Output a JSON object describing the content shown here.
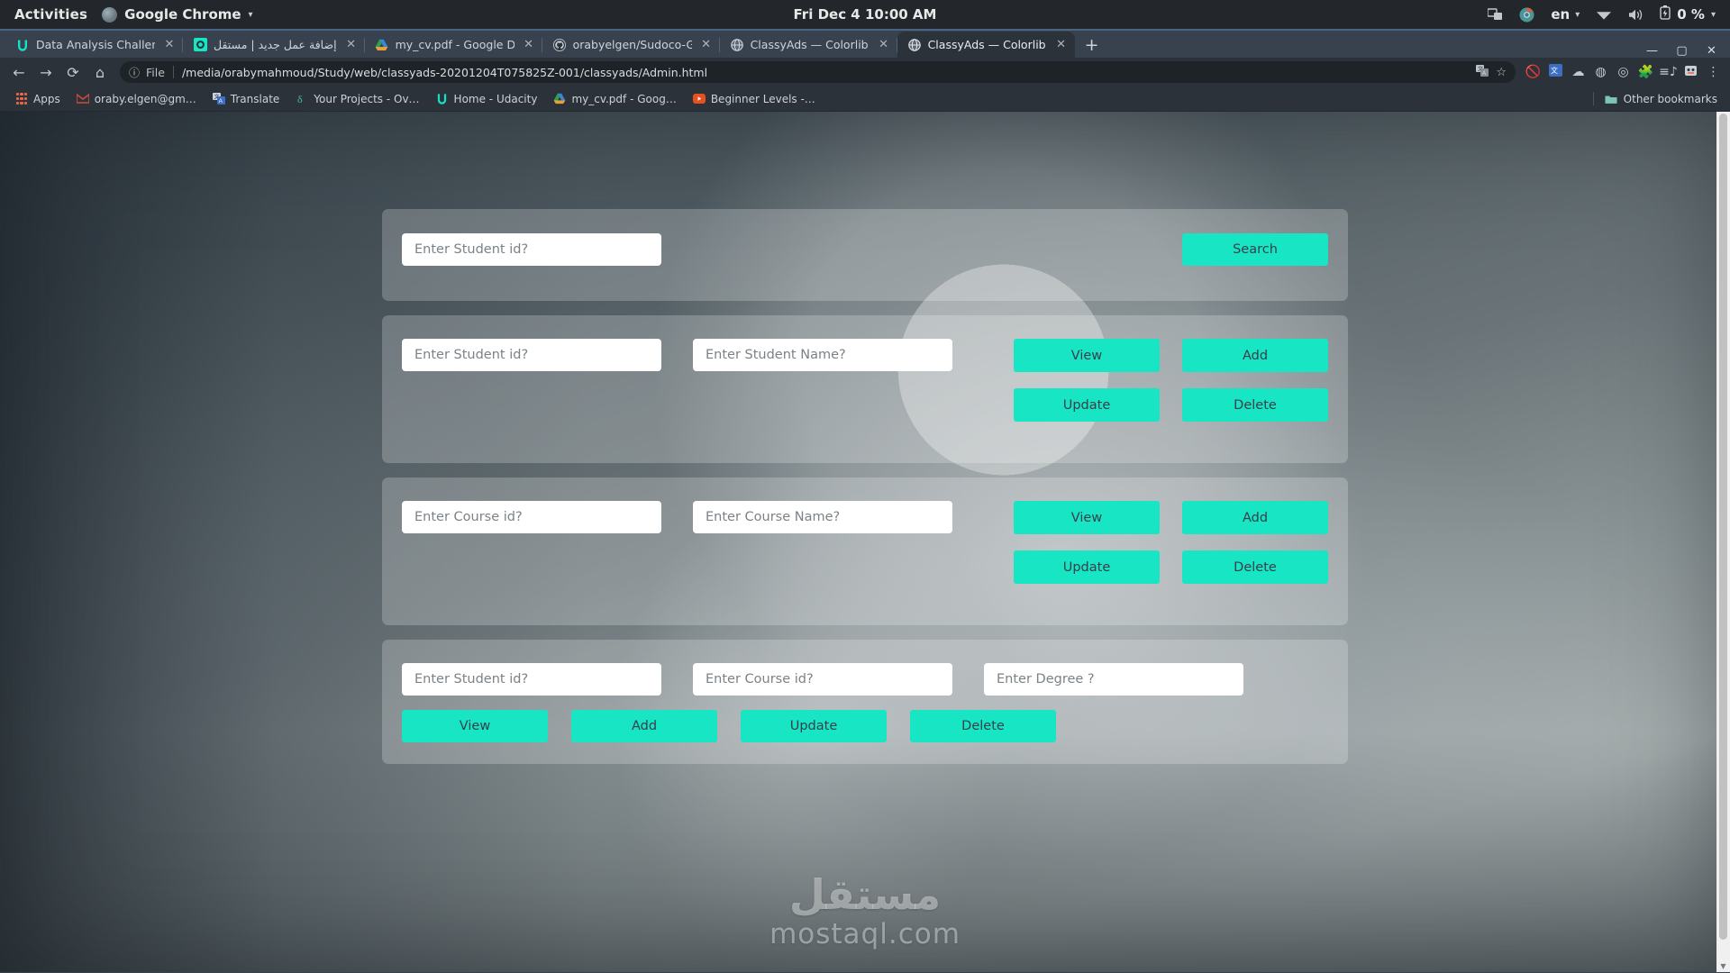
{
  "desktop": {
    "activities_label": "Activities",
    "app_menu_label": "Google Chrome",
    "app_menu_icon": "chrome-icon",
    "clock": "Fri Dec 4  10:00 AM",
    "tray": {
      "screencast_icon": "screen-share-icon",
      "chrome_icon": "chrome-tray-icon",
      "language": "en",
      "wifi_icon": "wifi-icon",
      "volume_icon": "volume-icon",
      "battery_icon": "battery-icon",
      "battery_level": "0 %"
    }
  },
  "browser": {
    "tabs": [
      {
        "label": "Data Analysis Challenger - Uda",
        "favicon": "udacity-icon",
        "active": false,
        "rtl": false
      },
      {
        "label": "إضافة عمل جديد | مستقل",
        "favicon": "mostaql-icon",
        "active": false,
        "rtl": true
      },
      {
        "label": "my_cv.pdf - Google Drive",
        "favicon": "google-drive-icon",
        "active": false,
        "rtl": false
      },
      {
        "label": "orabyelgen/Sudoco-Game",
        "favicon": "github-icon",
        "active": false,
        "rtl": false
      },
      {
        "label": "ClassyAds — Colorlib Website",
        "favicon": "globe-icon",
        "active": false,
        "rtl": false
      },
      {
        "label": "ClassyAds — Colorlib Website",
        "favicon": "globe-icon",
        "active": true,
        "rtl": false
      }
    ],
    "tab_close_glyph": "✕",
    "new_tab_label": "+",
    "window_controls": {
      "minimize": "—",
      "maximize": "▢",
      "close": "✕"
    },
    "nav": {
      "back_icon": "arrow-back-icon",
      "forward_icon": "arrow-forward-icon",
      "reload_icon": "reload-icon",
      "home_icon": "home-icon"
    },
    "omnibox": {
      "info_icon": "page-info-icon",
      "scheme_label": "File",
      "url": "/media/orabymahmoud/Study/web/classyads-20201204T075825Z-001/classyads/Admin.html",
      "translate_icon": "translate-icon",
      "bookmark_star_icon": "star-icon"
    },
    "toolbar_icons": [
      "extension-blocked-icon",
      "translate-extension-icon",
      "cloud-icon",
      "grammarly-icon",
      "video-downloader-icon",
      "puzzle-extensions-icon",
      "reading-list-icon",
      "profile-avatar-icon",
      "chrome-menu-icon"
    ],
    "bookmarks": [
      {
        "label": "Apps",
        "icon": "apps-grid-icon"
      },
      {
        "label": "oraby.elgen@gm…",
        "icon": "gmail-icon"
      },
      {
        "label": "Translate",
        "icon": "google-translate-icon"
      },
      {
        "label": "Your Projects - Ov…",
        "icon": "script-icon"
      },
      {
        "label": "Home - Udacity",
        "icon": "udacity-icon"
      },
      {
        "label": "my_cv.pdf - Goog…",
        "icon": "google-drive-icon"
      },
      {
        "label": "Beginner Levels -…",
        "icon": "youtube-icon"
      }
    ],
    "other_bookmarks": {
      "label": "Other bookmarks",
      "icon": "folder-icon"
    }
  },
  "page": {
    "watermark": {
      "arabic": "مستقل",
      "latin": "mostaql.com"
    },
    "panels": [
      {
        "name": "search-student-panel",
        "fields": [
          {
            "name": "student-id-search-input",
            "placeholder": "Enter Student id?",
            "value": ""
          }
        ],
        "buttons": [
          {
            "name": "search-button",
            "label": "Search"
          }
        ]
      },
      {
        "name": "student-crud-panel",
        "fields": [
          {
            "name": "student-id-input",
            "placeholder": "Enter Student id?",
            "value": ""
          },
          {
            "name": "student-name-input",
            "placeholder": "Enter Student Name?",
            "value": ""
          }
        ],
        "buttons": [
          {
            "name": "student-view-button",
            "label": "View"
          },
          {
            "name": "student-add-button",
            "label": "Add"
          },
          {
            "name": "student-update-button",
            "label": "Update"
          },
          {
            "name": "student-delete-button",
            "label": "Delete"
          }
        ]
      },
      {
        "name": "course-crud-panel",
        "fields": [
          {
            "name": "course-id-input",
            "placeholder": "Enter Course id?",
            "value": ""
          },
          {
            "name": "course-name-input",
            "placeholder": "Enter Course Name?",
            "value": ""
          }
        ],
        "buttons": [
          {
            "name": "course-view-button",
            "label": "View"
          },
          {
            "name": "course-add-button",
            "label": "Add"
          },
          {
            "name": "course-update-button",
            "label": "Update"
          },
          {
            "name": "course-delete-button",
            "label": "Delete"
          }
        ]
      },
      {
        "name": "enrollment-crud-panel",
        "fields": [
          {
            "name": "enrollment-student-id-input",
            "placeholder": "Enter Student id?",
            "value": ""
          },
          {
            "name": "enrollment-course-id-input",
            "placeholder": "Enter Course id?",
            "value": ""
          },
          {
            "name": "enrollment-degree-input",
            "placeholder": "Enter Degree ?",
            "value": ""
          }
        ],
        "buttons": [
          {
            "name": "enrollment-view-button",
            "label": "View"
          },
          {
            "name": "enrollment-add-button",
            "label": "Add"
          },
          {
            "name": "enrollment-update-button",
            "label": "Update"
          },
          {
            "name": "enrollment-delete-button",
            "label": "Delete"
          }
        ]
      }
    ]
  },
  "colors": {
    "accent_teal": "#17e5c4",
    "gnome_bar": "#23262a",
    "chrome_frame": "#38424f",
    "chrome_toolbar": "#2c3239",
    "panel_overlay": "rgba(255,255,255,0.22)"
  }
}
